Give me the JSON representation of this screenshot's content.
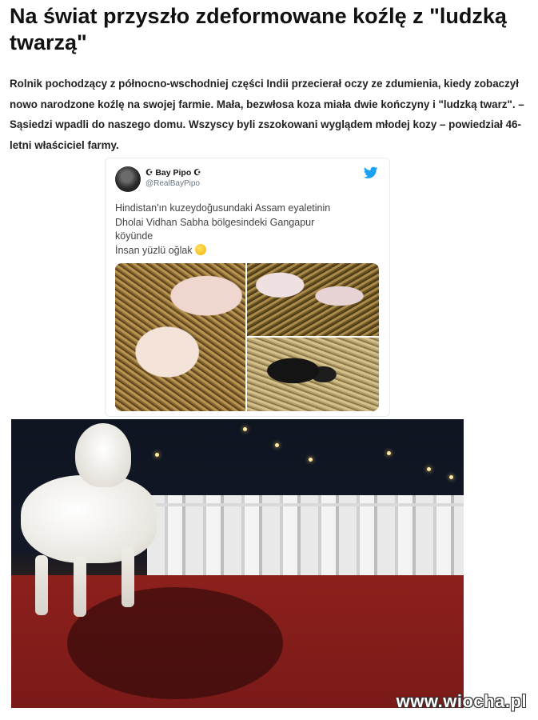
{
  "article": {
    "headline": "Na świat przyszło zdeformowane koźlę z \"ludzką twarzą\"",
    "lead": "Rolnik pochodzący z północno-wschodniej części Indii przecierał oczy ze zdumienia, kiedy zobaczył nowo narodzone koźlę na swojej farmie. Mała, bezwłosa koza miała dwie kończyny i \"ludzką twarz\". – Sąsiedzi wpadli do naszego domu. Wszyscy byli zszokowani wyglądem młodej kozy – powiedział 46-letni właściciel farmy."
  },
  "tweet": {
    "display_name": "☪︎ Bay Pipo ☪︎",
    "handle": "@RealBayPipo",
    "text_lines": [
      "Hindistan'ın kuzeydoğusundaki Assam eyaletinin",
      "Dholai Vidhan Sabha bölgesindeki Gangapur",
      "köyünde",
      "İnsan yüzlü oğlak"
    ],
    "emoji": "thinking-face-emoji",
    "icon": "twitter-bird-icon",
    "accent": "#1da1f2"
  },
  "watermark": "www.wiocha.pl"
}
